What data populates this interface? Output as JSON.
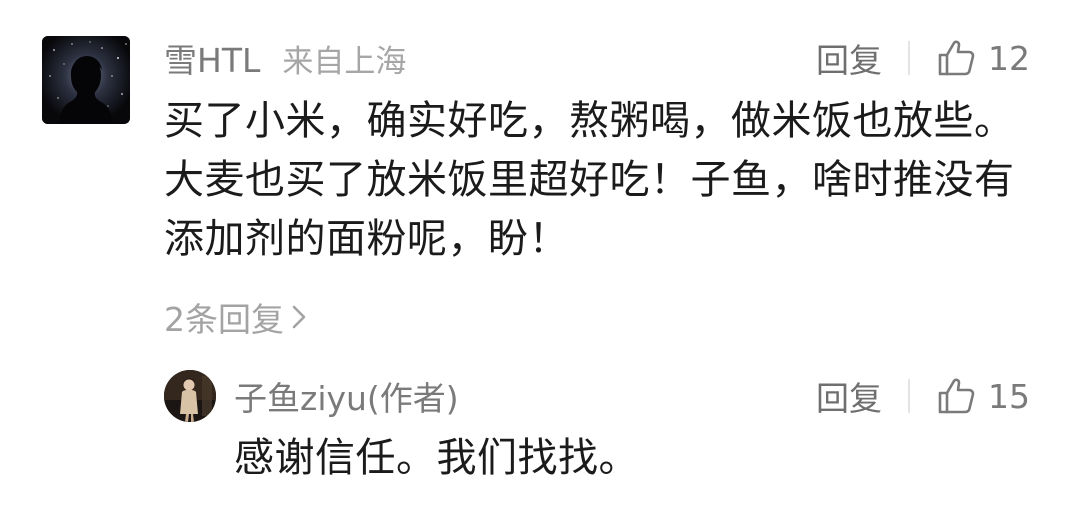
{
  "comment": {
    "user_name": "雪HTL",
    "location": "来自上海",
    "reply_label": "回复",
    "like_count": "12",
    "text": "买了小米，确实好吃，熬粥喝，做米饭也放些。大麦也买了放米饭里超好吃！子鱼，啥时推没有添加剂的面粉呢，盼！",
    "replies_link": "2条回复",
    "avatar_icon": "silhouette-starry-night-icon"
  },
  "reply": {
    "user_name": "子鱼ziyu(作者)",
    "reply_label": "回复",
    "like_count": "15",
    "text": "感谢信任。我们找找。",
    "avatar_icon": "author-portrait-avatar"
  },
  "icons": {
    "like": "thumbs-up-icon",
    "chevron": "chevron-right-icon"
  },
  "colors": {
    "primary_text": "#1b1b1b",
    "secondary_text": "#7a7a7a",
    "muted_text": "#a6a6a6"
  }
}
